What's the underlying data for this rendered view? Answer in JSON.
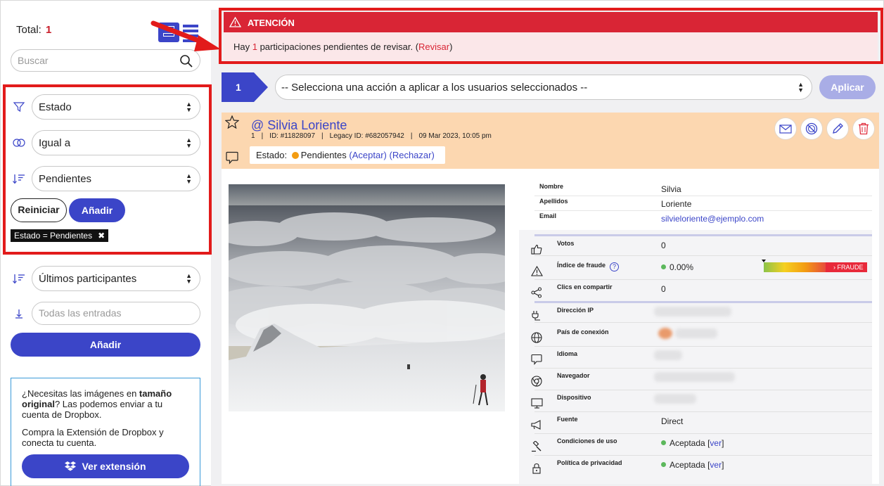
{
  "sidebar": {
    "total_label": "Total:",
    "total_value": "1",
    "search_placeholder": "Buscar",
    "filter": {
      "field": "Estado",
      "operator": "Igual a",
      "value": "Pendientes",
      "reset_label": "Reiniciar",
      "add_label": "Añadir",
      "active_tag": "Estado = Pendientes",
      "tag_close": "✖"
    },
    "sort": {
      "value": "Últimos participantes",
      "entries_placeholder": "Todas las entradas",
      "add_label": "Añadir"
    },
    "promo": {
      "line1_a": "¿Necesitas las imágenes en ",
      "line1_b": "tamaño original",
      "line1_c": "? Las podemos enviar a tu cuenta de Dropbox.",
      "line2": "Compra la Extensión de Dropbox y conecta tu cuenta.",
      "button": "Ver extensión"
    }
  },
  "alert": {
    "title": "ATENCIÓN",
    "text_before": "Hay ",
    "count": "1",
    "text_after": " participaciones pendientes de revisar. (",
    "link": "Revisar",
    "close_paren": ")"
  },
  "action_bar": {
    "step": "1",
    "select_value": "-- Selecciona una acción a aplicar a los usuarios seleccionados --",
    "apply_label": "Aplicar"
  },
  "entry": {
    "name": "@ Silvia Loriente",
    "index": "1",
    "id": "ID: #11828097",
    "legacy_id": "Legacy ID: #682057942",
    "date": "09 Mar 2023, 10:05 pm",
    "state_label": "Estado:",
    "state_value": "Pendientes",
    "accept": "(Aceptar)",
    "reject": "(Rechazar)",
    "details": [
      {
        "label": "Nombre",
        "value": "Silvia"
      },
      {
        "label": "Apellidos",
        "value": "Loriente"
      },
      {
        "label": "Email",
        "value": "silvieloriente@ejemplo.com"
      }
    ],
    "stats": {
      "votes_label": "Votos",
      "votes_value": "0",
      "fraud_label": "Índice de fraude",
      "fraud_help": "?",
      "fraud_value": "0.00%",
      "fraud_tag": "FRAUDE",
      "shares_label": "Clics en compartir",
      "shares_value": "0",
      "ip_label": "Dirección IP",
      "country_label": "País de conexión",
      "language_label": "Idioma",
      "browser_label": "Navegador",
      "device_label": "Dispositivo",
      "source_label": "Fuente",
      "source_value": "Direct",
      "terms_label": "Condiciones de uso",
      "terms_value": "Aceptada",
      "privacy_label": "Política de privacidad",
      "privacy_value": "Aceptada",
      "see_link": "ver",
      "bracket_open": "[",
      "bracket_close": "]"
    }
  },
  "colors": {
    "accent": "#3b45c8",
    "alert_red": "#d92535",
    "highlight_red": "#e21b1b",
    "card_header": "#fcd7b0",
    "pending_dot": "#f39c12"
  }
}
